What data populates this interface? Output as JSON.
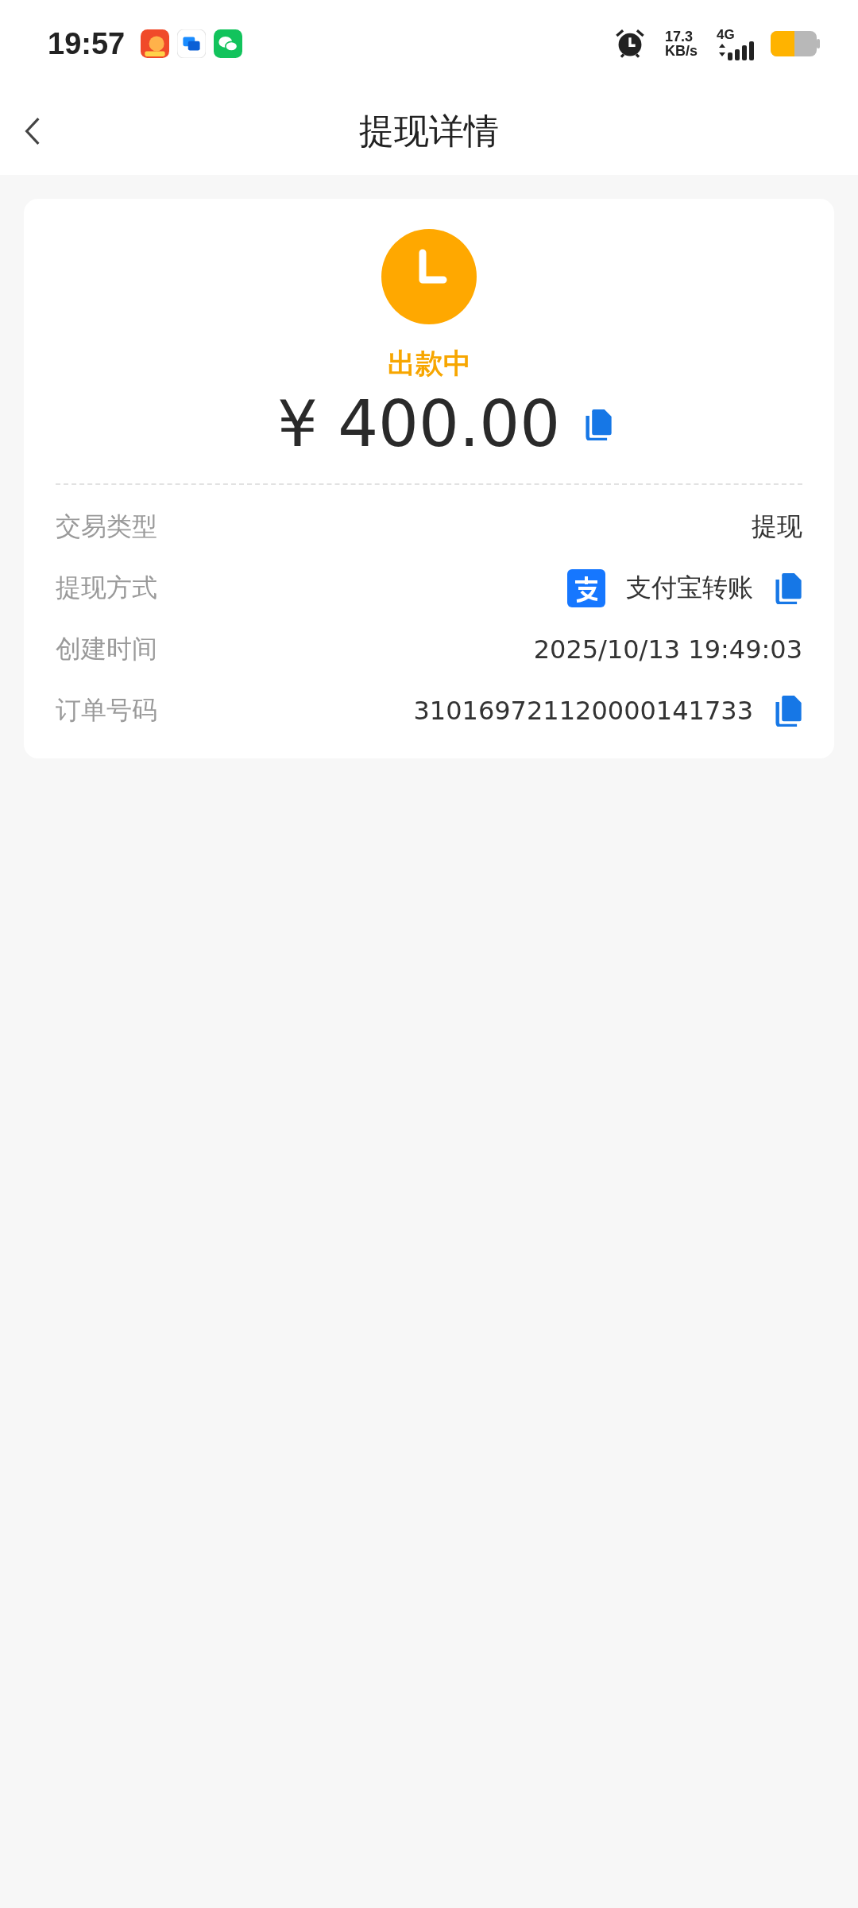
{
  "status_bar": {
    "time": "19:57",
    "speed_value": "17.3",
    "speed_unit": "KB/s",
    "network": "4G"
  },
  "nav": {
    "title": "提现详情"
  },
  "summary": {
    "status": "出款中",
    "amount": "¥ 400.00",
    "copyable": true
  },
  "details": [
    {
      "label": "交易类型",
      "value": "提现",
      "alipay_icon": false,
      "copyable": false
    },
    {
      "label": "提现方式",
      "value": "支付宝转账",
      "alipay_icon": true,
      "copyable": true
    },
    {
      "label": "创建时间",
      "value": "2025/10/13 19:49:03",
      "alipay_icon": false,
      "copyable": false
    },
    {
      "label": "订单号码",
      "value": "310169721120000141733",
      "alipay_icon": false,
      "copyable": true
    }
  ]
}
